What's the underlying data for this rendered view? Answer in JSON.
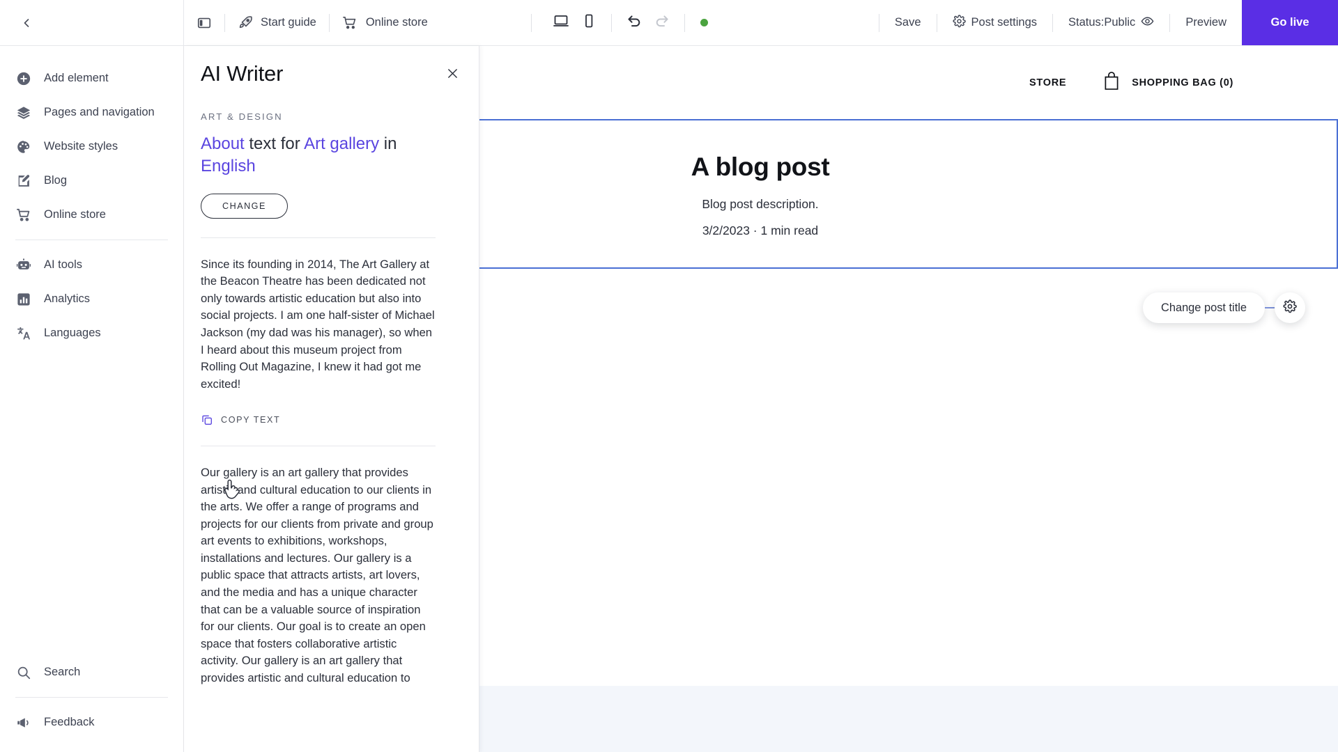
{
  "topbar": {
    "back_icon": "chevron-left-icon",
    "panel_toggle_icon": "sidebar-panel-icon",
    "start_guide": {
      "label": "Start guide",
      "icon": "rocket-icon"
    },
    "online_store": {
      "label": "Online store",
      "icon": "shopping-cart-icon"
    },
    "desktop_icon": "desktop-view-icon",
    "mobile_icon": "mobile-view-icon",
    "undo_icon": "undo-icon",
    "redo_icon": "redo-icon",
    "status_dot": "saved-indicator-dot",
    "status_dot_color": "#4ba33f",
    "save_label": "Save",
    "post_settings": {
      "label": "Post settings",
      "icon": "gear-icon"
    },
    "status": {
      "label": "Status:Public",
      "icon": "eye-icon"
    },
    "preview_label": "Preview",
    "go_live_label": "Go live",
    "go_live_color": "#5a2ee5"
  },
  "sidebar": {
    "items": [
      {
        "label": "Add element",
        "icon": "plus-circle-icon"
      },
      {
        "label": "Pages and navigation",
        "icon": "layers-icon"
      },
      {
        "label": "Website styles",
        "icon": "palette-icon"
      },
      {
        "label": "Blog",
        "icon": "blog-pencil-icon"
      },
      {
        "label": "Online store",
        "icon": "shopping-cart-icon"
      }
    ],
    "items_lower": [
      {
        "label": "AI tools",
        "icon": "robot-icon"
      },
      {
        "label": "Analytics",
        "icon": "bar-chart-icon"
      },
      {
        "label": "Languages",
        "icon": "translate-icon"
      }
    ],
    "bottom": [
      {
        "label": "Search",
        "icon": "search-icon"
      },
      {
        "label": "Feedback",
        "icon": "megaphone-icon"
      }
    ]
  },
  "panel": {
    "title": "AI Writer",
    "close_icon": "close-icon",
    "kicker": "ART & DESIGN",
    "prompt": {
      "part1": "About",
      "part2": " text for ",
      "part3": "Art gallery",
      "part4": " in ",
      "part5": "English"
    },
    "change_button": "CHANGE",
    "result_1": "Since its founding in 2014, The Art Gallery at the Beacon Theatre has been dedicated not only towards artistic education but also into social projects. I am one half-sister of Michael Jackson (my dad was his manager), so when I heard about this museum project from Rolling Out Magazine, I knew it had got me excited!",
    "copy_text": {
      "label": "COPY TEXT",
      "icon": "copy-icon"
    },
    "result_2": "Our gallery is an art gallery that provides artistic and cultural education to our clients in the arts. We offer a range of programs and projects for our clients from private and group art events to exhibitions, workshops, installations and lectures. Our gallery is a public space that attracts artists, art lovers, and the media and has a unique character that can be a valuable source of inspiration for our clients. Our goal is to create an open space that fosters collaborative artistic activity. Our gallery is an art gallery that provides artistic and cultural education to",
    "accent_color": "#5a45e0"
  },
  "canvas": {
    "nav": {
      "store_label": "STORE",
      "bag_label": "SHOPPING BAG (0)",
      "bag_icon": "shopping-bag-icon"
    },
    "post": {
      "title": "A blog post",
      "description": "Blog post description.",
      "meta": "3/2/2023 · 1 min read"
    },
    "selection_color": "#4a6fd4",
    "tooltip": {
      "label": "Change post title",
      "gear_icon": "gear-icon"
    }
  }
}
